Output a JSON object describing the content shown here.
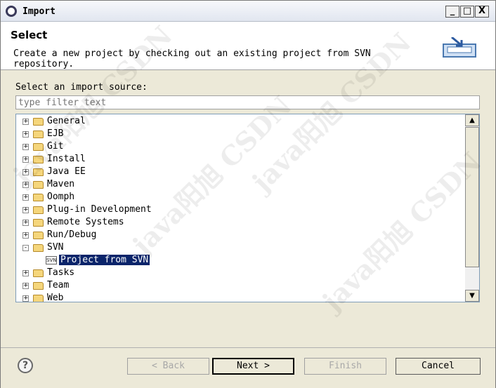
{
  "window": {
    "title": "Import",
    "minimize": "_",
    "maximize": "□",
    "close": "X"
  },
  "header": {
    "title": "Select",
    "description": "Create a new project by checking out an existing project from SVN repository."
  },
  "source": {
    "label": "Select an import source:",
    "filter_placeholder": "type filter text",
    "items": [
      {
        "label": "General",
        "expander": "+"
      },
      {
        "label": "EJB",
        "expander": "+"
      },
      {
        "label": "Git",
        "expander": "+"
      },
      {
        "label": "Install",
        "expander": "+"
      },
      {
        "label": "Java EE",
        "expander": "+"
      },
      {
        "label": "Maven",
        "expander": "+"
      },
      {
        "label": "Oomph",
        "expander": "+"
      },
      {
        "label": "Plug-in Development",
        "expander": "+"
      },
      {
        "label": "Remote Systems",
        "expander": "+"
      },
      {
        "label": "Run/Debug",
        "expander": "+"
      },
      {
        "label": "SVN",
        "expander": "-"
      },
      {
        "label": "Project from SVN",
        "icon": "svn-project-icon",
        "selected": true
      },
      {
        "label": "Tasks",
        "expander": "+"
      },
      {
        "label": "Team",
        "expander": "+"
      },
      {
        "label": "Web",
        "expander": "+"
      }
    ],
    "scroll_up": "▲",
    "scroll_down": "▼"
  },
  "buttons": {
    "help": "?",
    "back": "< Back",
    "next": "Next >",
    "finish": "Finish",
    "cancel": "Cancel"
  },
  "watermark": [
    "java阳旭 CSDN",
    "java阳旭 CSDN",
    "java阳旭 CSDN",
    "java阳旭 CSDN"
  ],
  "colors": {
    "selection": "#0a246a",
    "folder": "#f5d67c"
  }
}
